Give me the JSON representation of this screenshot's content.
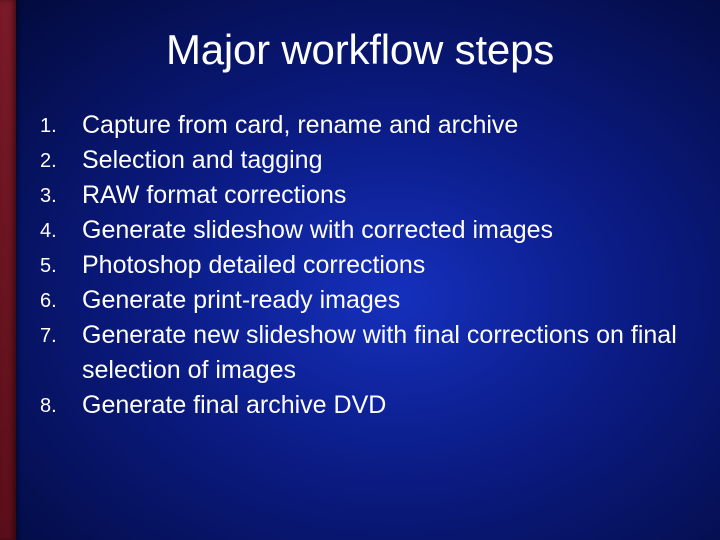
{
  "title": "Major workflow steps",
  "items": [
    {
      "num": "1.",
      "text": "Capture from card, rename and archive"
    },
    {
      "num": "2.",
      "text": "Selection and tagging"
    },
    {
      "num": "3.",
      "text": "RAW format corrections"
    },
    {
      "num": "4.",
      "text": "Generate slideshow with corrected images"
    },
    {
      "num": "5.",
      "text": "Photoshop detailed corrections"
    },
    {
      "num": "6.",
      "text": "Generate print-ready images"
    },
    {
      "num": "7.",
      "text": "Generate new slideshow with final corrections on final selection of images"
    },
    {
      "num": "8.",
      "text": "Generate final archive DVD"
    }
  ]
}
